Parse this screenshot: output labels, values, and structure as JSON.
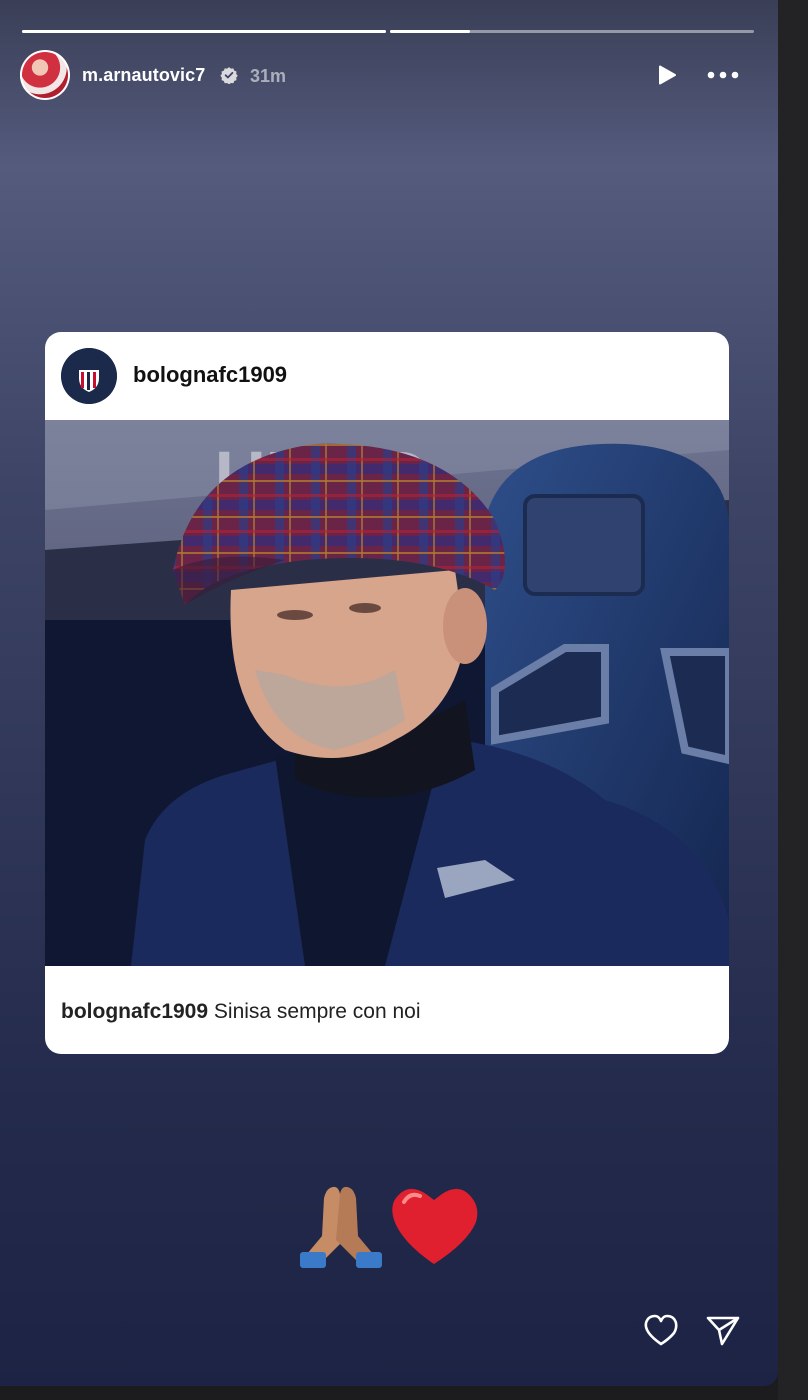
{
  "story": {
    "progress": [
      1.0,
      0.3
    ],
    "username": "m.arnautovic7",
    "verified": true,
    "time": "31m",
    "controls": {
      "play_icon": "play-icon",
      "more_icon": "more-horizontal-icon"
    }
  },
  "shared_post": {
    "account": "bolognafc1909",
    "caption_user": "bolognafc1909",
    "caption_text": "Sinisa sempre con noi"
  },
  "stickers": [
    "🙏🏽",
    "❤️"
  ],
  "actions": {
    "like_icon": "heart-icon",
    "share_icon": "paper-plane-icon"
  },
  "colors": {
    "card_bg": "#ffffff",
    "heart": "#e0202e"
  }
}
